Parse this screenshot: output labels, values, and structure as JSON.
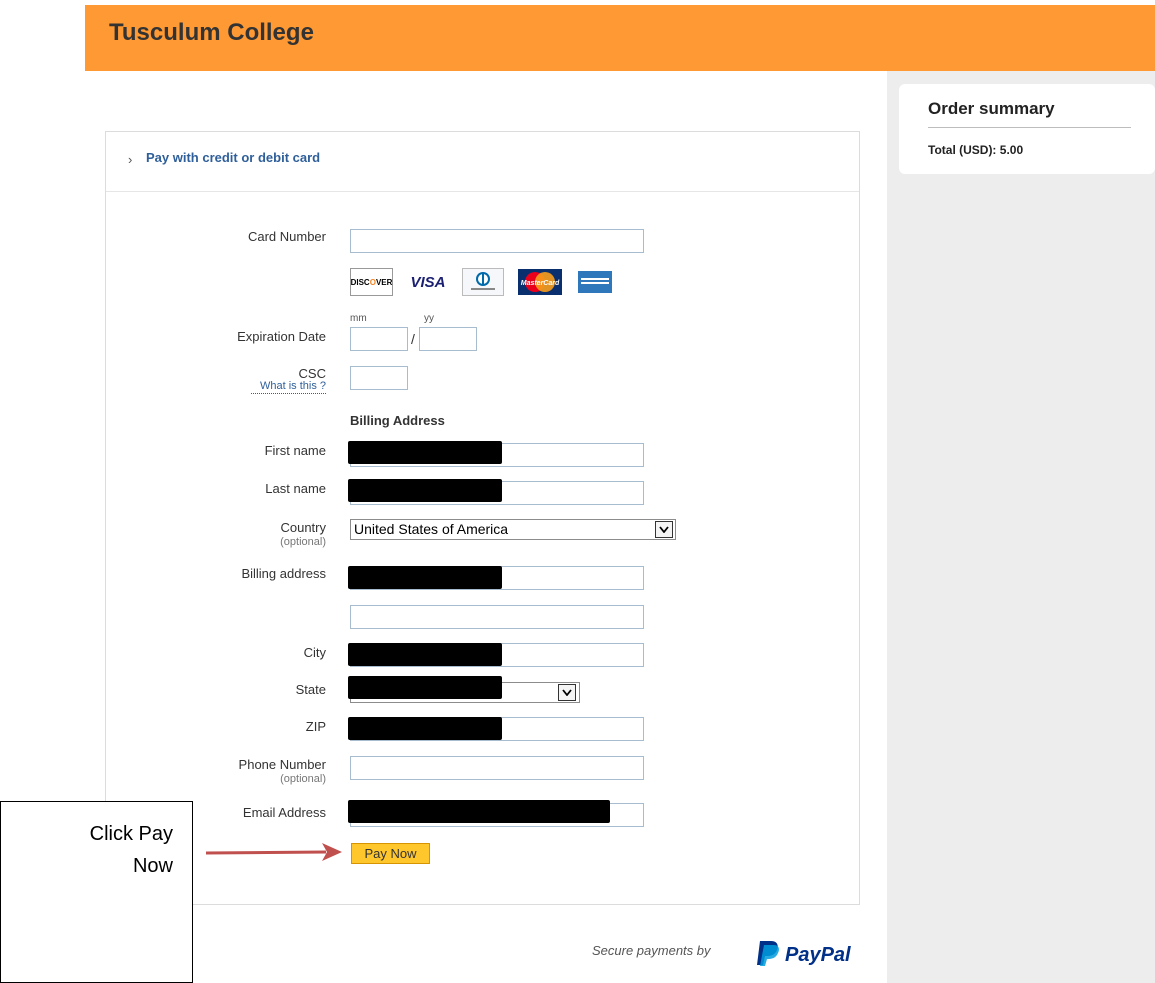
{
  "header": {
    "title": "Tusculum College",
    "color": "#ff9933"
  },
  "order_summary": {
    "title": "Order summary",
    "total": "Total (USD): 5.00"
  },
  "payment": {
    "section_title": "Pay with credit or debit card",
    "card_number_label": "Card Number",
    "card_logos": [
      {
        "name": "discover",
        "text_a": "DISC",
        "text_o": "O",
        "text_b": "VER"
      },
      {
        "name": "visa",
        "text": "VISA"
      },
      {
        "name": "diners-club"
      },
      {
        "name": "mastercard",
        "text": "MasterCard"
      },
      {
        "name": "american-express"
      }
    ],
    "expiration_label": "Expiration Date",
    "mm_label": "mm",
    "yy_label": "yy",
    "date_separator": "/",
    "csc_label": "CSC",
    "csc_help_link": "What is this ?",
    "billing_heading": "Billing Address",
    "first_name_label": "First name",
    "last_name_label": "Last name",
    "country_label": "Country",
    "optional_text": "(optional)",
    "country_value": "United States of America",
    "billing_address_label": "Billing address",
    "city_label": "City",
    "state_label": "State",
    "zip_label": "ZIP",
    "phone_label": "Phone Number",
    "email_label": "Email Address",
    "pay_now_label": "Pay Now"
  },
  "callout": {
    "text": "Click Pay\nNow",
    "arrow_color": "#c0504d"
  },
  "footer": {
    "secure_text": "Secure payments by",
    "paypal_text": "PayPal"
  }
}
